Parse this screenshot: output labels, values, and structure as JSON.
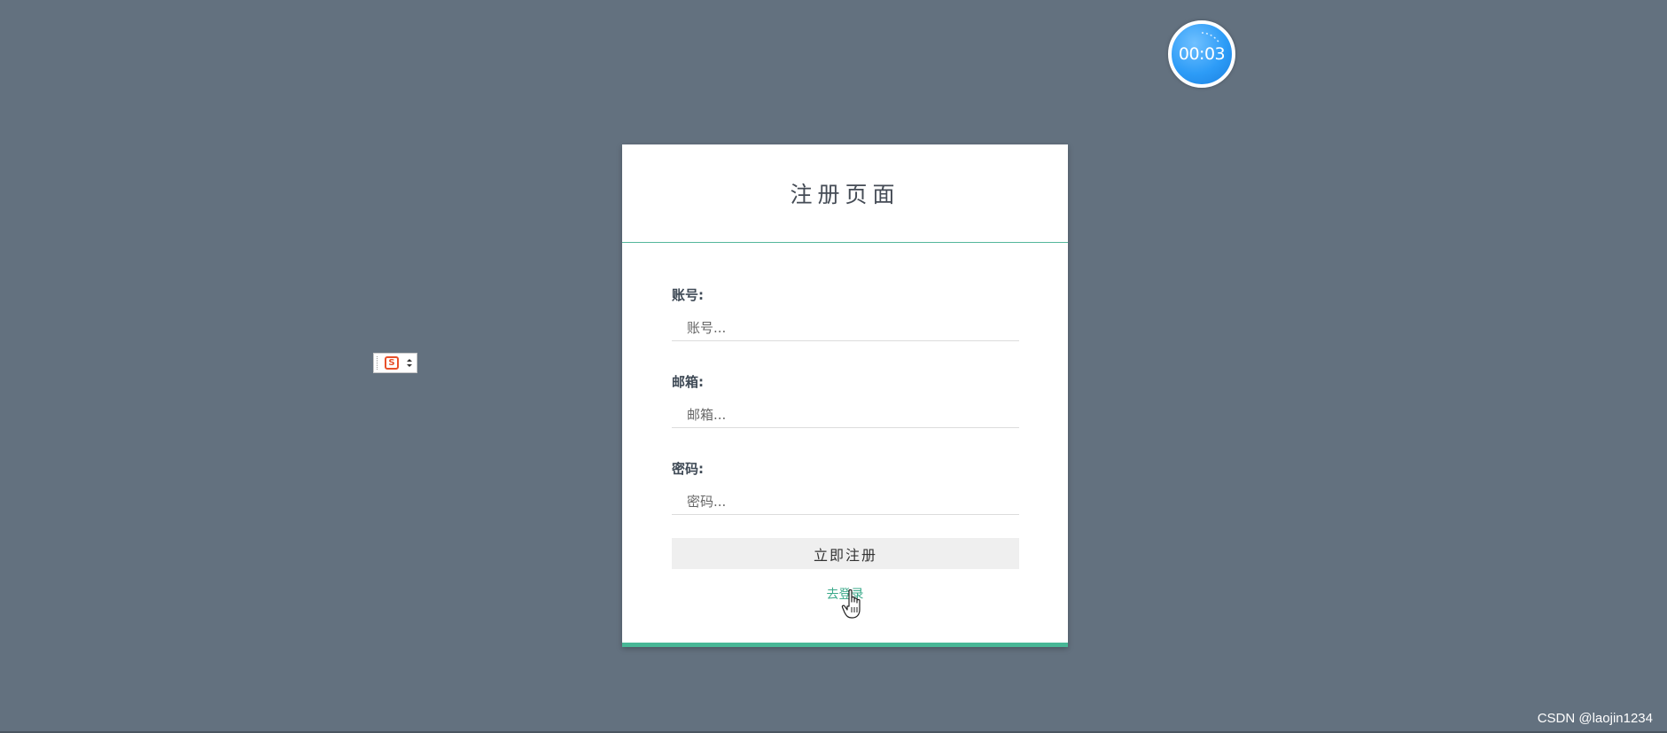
{
  "timer": {
    "text": "00:03"
  },
  "ime": {
    "logo_text": "S"
  },
  "card": {
    "title": "注册页面",
    "fields": [
      {
        "label": "账号:",
        "placeholder": "账号...",
        "value": ""
      },
      {
        "label": "邮箱:",
        "placeholder": "邮箱...",
        "value": ""
      },
      {
        "label": "密码:",
        "placeholder": "密码...",
        "value": ""
      }
    ],
    "submit_label": "立即注册",
    "login_link_label": "去登录"
  },
  "colors": {
    "background": "#63717f",
    "accent": "#48b796",
    "link": "#3aa98a",
    "timer": "#2d9cf7"
  },
  "watermark": "CSDN @laojin1234"
}
